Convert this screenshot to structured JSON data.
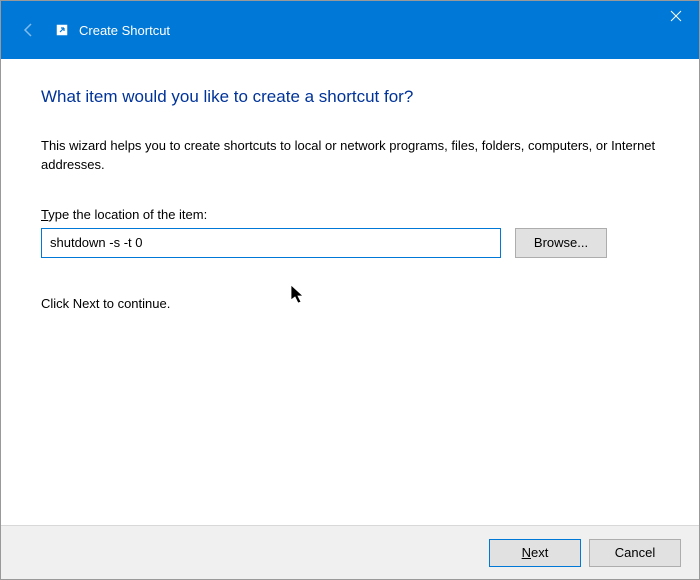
{
  "titlebar": {
    "title": "Create Shortcut"
  },
  "content": {
    "heading": "What item would you like to create a shortcut for?",
    "description": "This wizard helps you to create shortcuts to local or network programs, files, folders, computers, or Internet addresses.",
    "field_label_prefix": "T",
    "field_label_rest": "ype the location of the item:",
    "location_value": "shutdown -s -t 0",
    "browse_label": "Browse...",
    "continue_text": "Click Next to continue."
  },
  "footer": {
    "next_prefix": "N",
    "next_rest": "ext",
    "cancel_label": "Cancel"
  }
}
